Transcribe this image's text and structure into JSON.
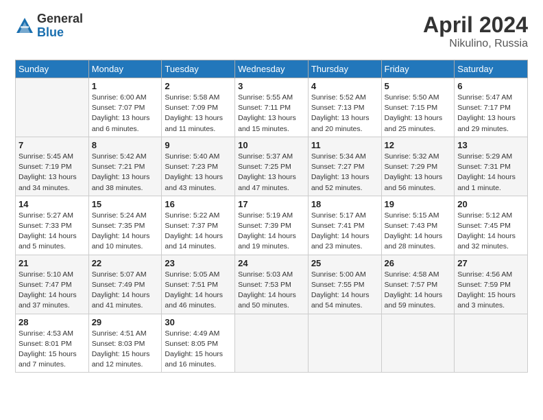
{
  "logo": {
    "general": "General",
    "blue": "Blue"
  },
  "title": "April 2024",
  "location": "Nikulino, Russia",
  "days_of_week": [
    "Sunday",
    "Monday",
    "Tuesday",
    "Wednesday",
    "Thursday",
    "Friday",
    "Saturday"
  ],
  "weeks": [
    [
      {
        "num": "",
        "sunrise": "",
        "sunset": "",
        "daylight": ""
      },
      {
        "num": "1",
        "sunrise": "Sunrise: 6:00 AM",
        "sunset": "Sunset: 7:07 PM",
        "daylight": "Daylight: 13 hours and 6 minutes."
      },
      {
        "num": "2",
        "sunrise": "Sunrise: 5:58 AM",
        "sunset": "Sunset: 7:09 PM",
        "daylight": "Daylight: 13 hours and 11 minutes."
      },
      {
        "num": "3",
        "sunrise": "Sunrise: 5:55 AM",
        "sunset": "Sunset: 7:11 PM",
        "daylight": "Daylight: 13 hours and 15 minutes."
      },
      {
        "num": "4",
        "sunrise": "Sunrise: 5:52 AM",
        "sunset": "Sunset: 7:13 PM",
        "daylight": "Daylight: 13 hours and 20 minutes."
      },
      {
        "num": "5",
        "sunrise": "Sunrise: 5:50 AM",
        "sunset": "Sunset: 7:15 PM",
        "daylight": "Daylight: 13 hours and 25 minutes."
      },
      {
        "num": "6",
        "sunrise": "Sunrise: 5:47 AM",
        "sunset": "Sunset: 7:17 PM",
        "daylight": "Daylight: 13 hours and 29 minutes."
      }
    ],
    [
      {
        "num": "7",
        "sunrise": "Sunrise: 5:45 AM",
        "sunset": "Sunset: 7:19 PM",
        "daylight": "Daylight: 13 hours and 34 minutes."
      },
      {
        "num": "8",
        "sunrise": "Sunrise: 5:42 AM",
        "sunset": "Sunset: 7:21 PM",
        "daylight": "Daylight: 13 hours and 38 minutes."
      },
      {
        "num": "9",
        "sunrise": "Sunrise: 5:40 AM",
        "sunset": "Sunset: 7:23 PM",
        "daylight": "Daylight: 13 hours and 43 minutes."
      },
      {
        "num": "10",
        "sunrise": "Sunrise: 5:37 AM",
        "sunset": "Sunset: 7:25 PM",
        "daylight": "Daylight: 13 hours and 47 minutes."
      },
      {
        "num": "11",
        "sunrise": "Sunrise: 5:34 AM",
        "sunset": "Sunset: 7:27 PM",
        "daylight": "Daylight: 13 hours and 52 minutes."
      },
      {
        "num": "12",
        "sunrise": "Sunrise: 5:32 AM",
        "sunset": "Sunset: 7:29 PM",
        "daylight": "Daylight: 13 hours and 56 minutes."
      },
      {
        "num": "13",
        "sunrise": "Sunrise: 5:29 AM",
        "sunset": "Sunset: 7:31 PM",
        "daylight": "Daylight: 14 hours and 1 minute."
      }
    ],
    [
      {
        "num": "14",
        "sunrise": "Sunrise: 5:27 AM",
        "sunset": "Sunset: 7:33 PM",
        "daylight": "Daylight: 14 hours and 5 minutes."
      },
      {
        "num": "15",
        "sunrise": "Sunrise: 5:24 AM",
        "sunset": "Sunset: 7:35 PM",
        "daylight": "Daylight: 14 hours and 10 minutes."
      },
      {
        "num": "16",
        "sunrise": "Sunrise: 5:22 AM",
        "sunset": "Sunset: 7:37 PM",
        "daylight": "Daylight: 14 hours and 14 minutes."
      },
      {
        "num": "17",
        "sunrise": "Sunrise: 5:19 AM",
        "sunset": "Sunset: 7:39 PM",
        "daylight": "Daylight: 14 hours and 19 minutes."
      },
      {
        "num": "18",
        "sunrise": "Sunrise: 5:17 AM",
        "sunset": "Sunset: 7:41 PM",
        "daylight": "Daylight: 14 hours and 23 minutes."
      },
      {
        "num": "19",
        "sunrise": "Sunrise: 5:15 AM",
        "sunset": "Sunset: 7:43 PM",
        "daylight": "Daylight: 14 hours and 28 minutes."
      },
      {
        "num": "20",
        "sunrise": "Sunrise: 5:12 AM",
        "sunset": "Sunset: 7:45 PM",
        "daylight": "Daylight: 14 hours and 32 minutes."
      }
    ],
    [
      {
        "num": "21",
        "sunrise": "Sunrise: 5:10 AM",
        "sunset": "Sunset: 7:47 PM",
        "daylight": "Daylight: 14 hours and 37 minutes."
      },
      {
        "num": "22",
        "sunrise": "Sunrise: 5:07 AM",
        "sunset": "Sunset: 7:49 PM",
        "daylight": "Daylight: 14 hours and 41 minutes."
      },
      {
        "num": "23",
        "sunrise": "Sunrise: 5:05 AM",
        "sunset": "Sunset: 7:51 PM",
        "daylight": "Daylight: 14 hours and 46 minutes."
      },
      {
        "num": "24",
        "sunrise": "Sunrise: 5:03 AM",
        "sunset": "Sunset: 7:53 PM",
        "daylight": "Daylight: 14 hours and 50 minutes."
      },
      {
        "num": "25",
        "sunrise": "Sunrise: 5:00 AM",
        "sunset": "Sunset: 7:55 PM",
        "daylight": "Daylight: 14 hours and 54 minutes."
      },
      {
        "num": "26",
        "sunrise": "Sunrise: 4:58 AM",
        "sunset": "Sunset: 7:57 PM",
        "daylight": "Daylight: 14 hours and 59 minutes."
      },
      {
        "num": "27",
        "sunrise": "Sunrise: 4:56 AM",
        "sunset": "Sunset: 7:59 PM",
        "daylight": "Daylight: 15 hours and 3 minutes."
      }
    ],
    [
      {
        "num": "28",
        "sunrise": "Sunrise: 4:53 AM",
        "sunset": "Sunset: 8:01 PM",
        "daylight": "Daylight: 15 hours and 7 minutes."
      },
      {
        "num": "29",
        "sunrise": "Sunrise: 4:51 AM",
        "sunset": "Sunset: 8:03 PM",
        "daylight": "Daylight: 15 hours and 12 minutes."
      },
      {
        "num": "30",
        "sunrise": "Sunrise: 4:49 AM",
        "sunset": "Sunset: 8:05 PM",
        "daylight": "Daylight: 15 hours and 16 minutes."
      },
      {
        "num": "",
        "sunrise": "",
        "sunset": "",
        "daylight": ""
      },
      {
        "num": "",
        "sunrise": "",
        "sunset": "",
        "daylight": ""
      },
      {
        "num": "",
        "sunrise": "",
        "sunset": "",
        "daylight": ""
      },
      {
        "num": "",
        "sunrise": "",
        "sunset": "",
        "daylight": ""
      }
    ]
  ]
}
